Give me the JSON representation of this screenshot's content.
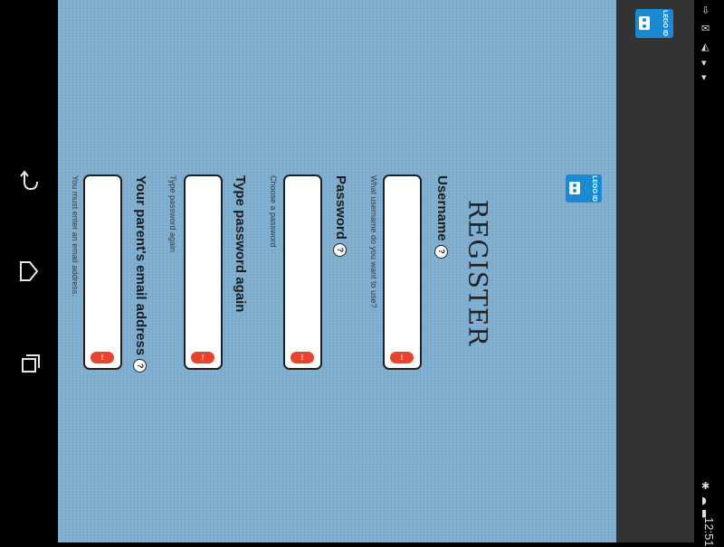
{
  "nav": {
    "back_icon": "back-arrow-icon",
    "home_icon": "home-icon",
    "recents_icon": "recent-apps-icon"
  },
  "header": {
    "logo_text": "LEGO ID"
  },
  "form": {
    "logo_text": "LEGO ID",
    "title": "REGISTER",
    "fields": [
      {
        "label": "Username",
        "help": "?",
        "hint": "What username do you want to use?",
        "error_badge": "!"
      },
      {
        "label": "Password",
        "help": "?",
        "hint": "Choose a password",
        "error_badge": "!"
      },
      {
        "label": "Type password again",
        "help": "",
        "hint": "Type password again",
        "error_badge": "!"
      },
      {
        "label": "Your parent's email address",
        "help": "?",
        "hint": "You must enter an email address.",
        "error_badge": "!"
      }
    ]
  },
  "statusbar": {
    "time": "12:51",
    "icons": [
      "download-icon",
      "mail-icon",
      "warning-icon",
      "download-icon",
      "bluetooth-icon",
      "wifi-icon",
      "battery-icon"
    ]
  },
  "colors": {
    "background": "#7eafd0",
    "accent": "#1a8ad4",
    "error": "#e8432b",
    "appbar": "#333333"
  }
}
